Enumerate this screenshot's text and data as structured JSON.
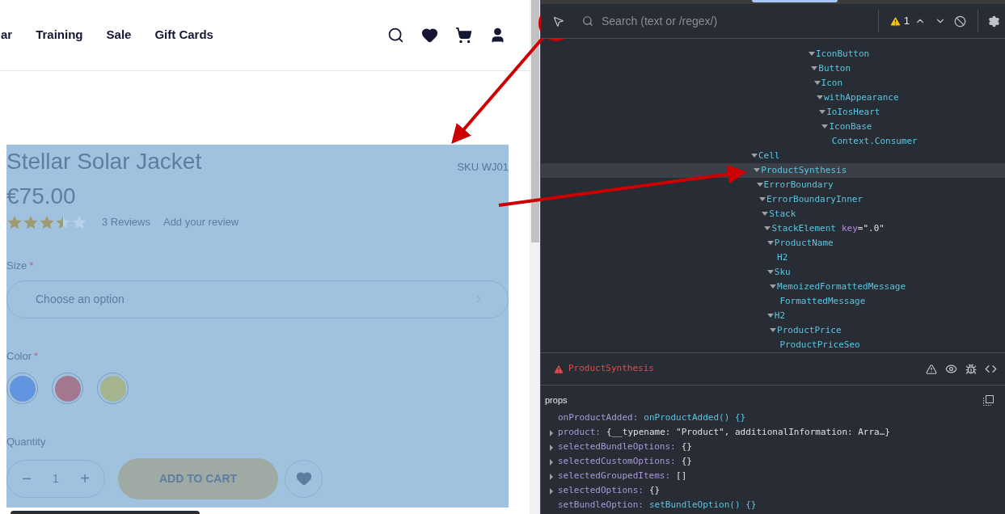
{
  "shop": {
    "nav": [
      "ar",
      "Training",
      "Sale",
      "Gift Cards"
    ],
    "product": {
      "name": "Stellar Solar Jacket",
      "sku": "SKU WJ01",
      "price": "€75.00",
      "stars": 3.5,
      "reviews": "3 Reviews",
      "add_review": "Add your review",
      "size": {
        "label": "Size",
        "required": "*",
        "placeholder": "Choose an option"
      },
      "color": {
        "label": "Color",
        "required": "*",
        "swatches": [
          {
            "color": "#6394df"
          },
          {
            "color": "#a3788f"
          },
          {
            "color": "#a3b48f"
          }
        ]
      },
      "quantity": {
        "label": "Quantity",
        "value": "1",
        "minus": "−",
        "plus": "+"
      },
      "add_to_cart": "ADD TO CART"
    }
  },
  "devtools": {
    "search": {
      "placeholder": "Search (text or /regex/)"
    },
    "warnings": "1",
    "tree": [
      {
        "name": "IconButton",
        "selected": false,
        "expanded": true,
        "children": [
          {
            "name": "Button",
            "selected": false,
            "expanded": true,
            "children": [
              {
                "name": "Icon",
                "selected": false,
                "expanded": true,
                "children": [
                  {
                    "name": "withAppearance",
                    "selected": false,
                    "expanded": true,
                    "children": [
                      {
                        "name": "IoIosHeart",
                        "selected": false,
                        "expanded": true,
                        "children": [
                          {
                            "name": "IconBase",
                            "selected": false,
                            "expanded": true,
                            "children": [
                              {
                                "name": "Context.Consumer",
                                "selected": false
                              }
                            ]
                          }
                        ]
                      }
                    ]
                  }
                ]
              }
            ]
          }
        ]
      },
      {
        "name": "Cell",
        "selected": false,
        "expanded": true,
        "children": [
          {
            "name": "ProductSynthesis",
            "selected": true,
            "expanded": true,
            "children": [
              {
                "name": "ErrorBoundary",
                "selected": false,
                "expanded": true,
                "children": [
                  {
                    "name": "ErrorBoundaryInner",
                    "selected": false,
                    "expanded": true,
                    "children": [
                      {
                        "name": "Stack",
                        "selected": false,
                        "expanded": true,
                        "children": [
                          {
                            "name": "StackElement",
                            "key_label": "key",
                            "key_value": "=\".0\"",
                            "selected": false,
                            "expanded": true,
                            "children": [
                              {
                                "name": "ProductName",
                                "selected": false,
                                "expanded": true,
                                "children": [
                                  {
                                    "name": "H2",
                                    "selected": false
                                  }
                                ]
                              },
                              {
                                "name": "Sku",
                                "selected": false,
                                "expanded": true,
                                "children": [
                                  {
                                    "name": "MemoizedFormattedMessage",
                                    "selected": false,
                                    "expanded": true,
                                    "children": [
                                      {
                                        "name": "FormattedMessage",
                                        "selected": false
                                      }
                                    ]
                                  }
                                ]
                              },
                              {
                                "name": "H2",
                                "selected": false,
                                "expanded": true,
                                "children": [
                                  {
                                    "name": "ProductPrice",
                                    "selected": false,
                                    "expanded": true,
                                    "children": [
                                      {
                                        "name": "ProductPriceSeo",
                                        "selected": false
                                      }
                                    ]
                                  }
                                ]
                              }
                            ]
                          }
                        ]
                      }
                    ]
                  }
                ]
              }
            ]
          }
        ]
      }
    ],
    "component": {
      "name": "ProductSynthesis",
      "section": "props",
      "props": [
        {
          "kind": "function",
          "key": "onProductAdded:",
          "value": "onProductAdded() {}"
        },
        {
          "kind": "object",
          "key": "product:",
          "value": "{__typename: \"Product\", additionalInformation: Arra…}",
          "expanded": false
        },
        {
          "kind": "object",
          "key": "selectedBundleOptions:",
          "value": "{}",
          "expanded": false
        },
        {
          "kind": "object",
          "key": "selectedCustomOptions:",
          "value": "{}",
          "expanded": false
        },
        {
          "kind": "object",
          "key": "selectedGroupedItems:",
          "value": "[]",
          "expanded": false
        },
        {
          "kind": "object",
          "key": "selectedOptions:",
          "value": "{}",
          "expanded": false
        },
        {
          "kind": "function",
          "key": "setBundleOption:",
          "value": "setBundleOption() {}"
        }
      ]
    }
  }
}
